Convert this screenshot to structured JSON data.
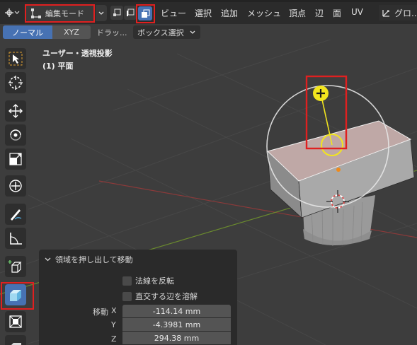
{
  "header": {
    "mode_label": "編集モード",
    "menu": [
      "ビュー",
      "選択",
      "追加",
      "メッシュ",
      "頂点",
      "辺",
      "面",
      "UV"
    ],
    "transform_orientation": "グロ..."
  },
  "toolbar2": {
    "orientation_normal": "ノーマル",
    "orientation_xyz": "XYZ",
    "drag_label": "ドラッ...",
    "box_select": "ボックス選択"
  },
  "viewport": {
    "view_name": "ユーザー・透視投影",
    "object_name": "(1) 平面"
  },
  "redo_panel": {
    "title": "領域を押し出して移動",
    "flip_normals": "法線を反転",
    "dissolve_orthogonal": "直交する辺を溶解",
    "move_label": "移動",
    "x_label": "X",
    "y_label": "Y",
    "z_label": "Z",
    "x_value": "-114.14 mm",
    "y_value": "-4.3981 mm",
    "z_value": "294.38 mm"
  },
  "colors": {
    "accent": "#4772b3",
    "highlight": "#e02020",
    "gizmo_yellow": "#f2e51e"
  },
  "icons": [
    "editor-type-icon",
    "edit-mode-icon",
    "vertex-select-icon",
    "edge-select-icon",
    "face-select-icon",
    "transform-orientation-icon",
    "select-box-icon",
    "cursor-icon",
    "move-icon",
    "rotate-icon",
    "scale-icon",
    "transform-icon",
    "annotate-icon",
    "measure-icon",
    "add-cube-icon",
    "extrude-region-icon",
    "inset-faces-icon",
    "bevel-icon"
  ]
}
